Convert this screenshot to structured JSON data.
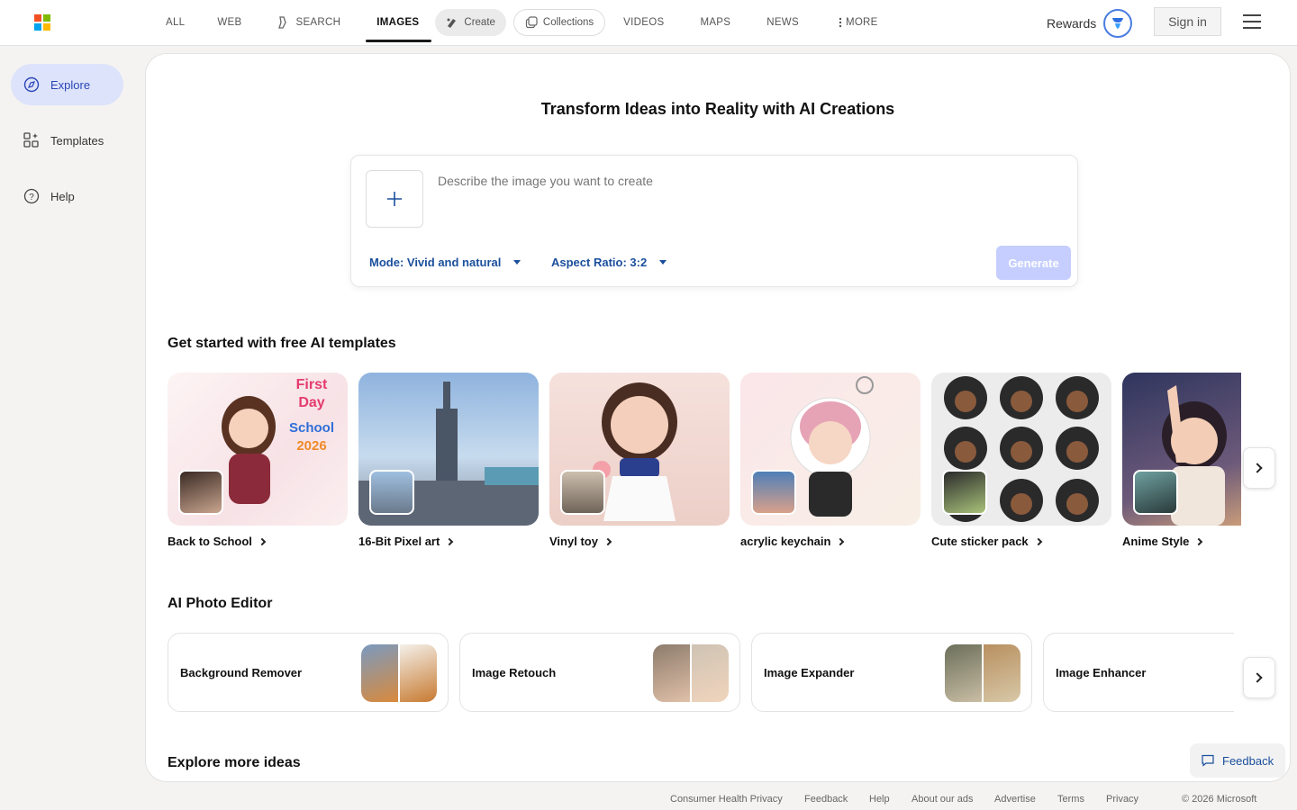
{
  "header": {
    "nav": [
      {
        "label": "ALL"
      },
      {
        "label": "WEB"
      },
      {
        "label": "SEARCH"
      },
      {
        "label": "IMAGES"
      },
      {
        "label": "Create"
      },
      {
        "label": "Collections"
      },
      {
        "label": "VIDEOS"
      },
      {
        "label": "MAPS"
      },
      {
        "label": "NEWS"
      },
      {
        "label": "MORE"
      }
    ],
    "rewards_label": "Rewards",
    "signin_label": "Sign in"
  },
  "sidebar": {
    "items": [
      {
        "label": "Explore",
        "icon": "explore-icon"
      },
      {
        "label": "Templates",
        "icon": "templates-icon"
      },
      {
        "label": "Help",
        "icon": "help-icon"
      }
    ]
  },
  "hero": {
    "title": "Transform Ideas into Reality with AI Creations",
    "placeholder": "Describe the image you want to create",
    "mode_label": "Mode: Vivid and natural",
    "aspect_label": "Aspect Ratio: 3:2",
    "generate_label": "Generate"
  },
  "templates": {
    "title": "Get started with free AI templates",
    "items": [
      {
        "label": "Back to School",
        "colors": [
          "#fbeff0",
          "#8b2a3a"
        ]
      },
      {
        "label": "16-Bit Pixel art",
        "colors": [
          "#a8c7e8",
          "#6b7a8c"
        ]
      },
      {
        "label": "Vinyl toy",
        "colors": [
          "#f4dcd6",
          "#2b3f8f"
        ]
      },
      {
        "label": "acrylic keychain",
        "colors": [
          "#fbe3e6",
          "#e6a3b5"
        ]
      },
      {
        "label": "Cute sticker pack",
        "colors": [
          "#e9e9e9",
          "#2a2a2a"
        ]
      },
      {
        "label": "Anime Style",
        "colors": [
          "#3d4470",
          "#e8b27a"
        ]
      }
    ]
  },
  "editor": {
    "title": "AI Photo Editor",
    "items": [
      {
        "label": "Background Remover",
        "colors": [
          "#d98a3c",
          "#c77a30"
        ]
      },
      {
        "label": "Image Retouch",
        "colors": [
          "#8d7c6c",
          "#cfc3b4"
        ]
      },
      {
        "label": "Image Expander",
        "colors": [
          "#6b6f5a",
          "#b89060"
        ]
      },
      {
        "label": "Image Enhancer",
        "colors": [
          "#9aa3b0",
          "#9aa3b0"
        ]
      }
    ]
  },
  "explore_title": "Explore more ideas",
  "feedback_label": "Feedback",
  "footer": {
    "links": [
      "Consumer Health Privacy",
      "Feedback",
      "Help",
      "About our ads",
      "Advertise",
      "Terms",
      "Privacy",
      "© 2026 Microsoft"
    ]
  },
  "colors": {
    "accent": "#1b4f9c",
    "explore_bg": "#dde3fa",
    "generate_disabled": "#c5ceff"
  }
}
